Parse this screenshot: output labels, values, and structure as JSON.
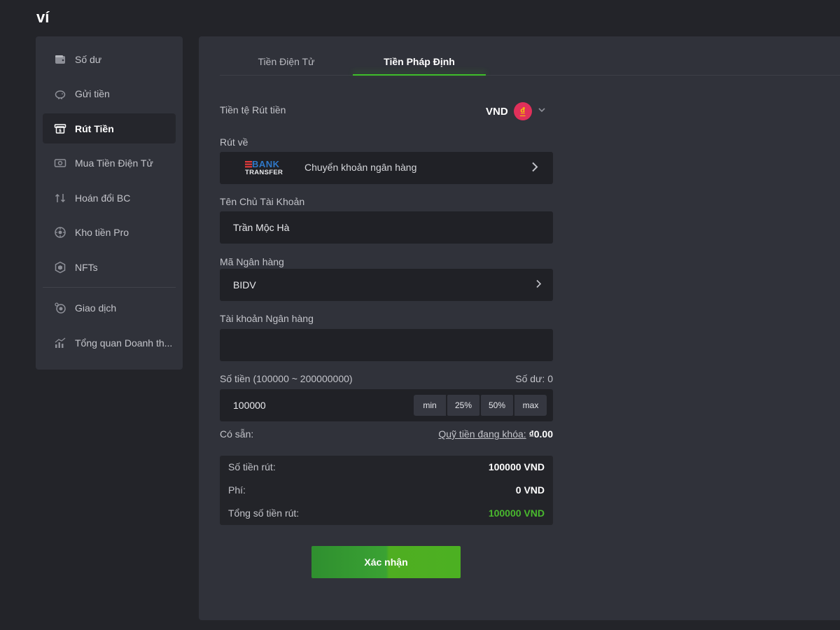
{
  "page": {
    "title": "ví"
  },
  "sidebar": {
    "items": [
      {
        "label": "Số dư",
        "icon": "wallet-icon"
      },
      {
        "label": "Gửi tiền",
        "icon": "piggy-bank-icon"
      },
      {
        "label": "Rút Tiền",
        "icon": "withdraw-icon",
        "active": true
      },
      {
        "label": "Mua Tiền Điện Tử",
        "icon": "buy-crypto-icon"
      },
      {
        "label": "Hoán đổi BC",
        "icon": "swap-icon"
      },
      {
        "label": "Kho tiền Pro",
        "icon": "vault-icon"
      },
      {
        "label": "NFTs",
        "icon": "nft-icon"
      },
      {
        "label": "Giao dịch",
        "icon": "transactions-icon"
      },
      {
        "label": "Tổng quan Doanh th...",
        "icon": "chart-icon"
      }
    ]
  },
  "tabs": [
    {
      "label": "Tiền Điện Tử"
    },
    {
      "label": "Tiền Pháp Định",
      "active": true
    }
  ],
  "form": {
    "currency_label": "Tiền tệ Rút tiền",
    "currency_code": "VND",
    "currency_symbol": "₫",
    "withdraw_to_label": "Rút về",
    "bank_logo_top": "BANK",
    "bank_logo_bottom": "TRANSFER",
    "withdraw_method": "Chuyển khoản ngân hàng",
    "account_name_label": "Tên Chủ Tài Khoản",
    "account_name_value": "Trần Mộc Hà",
    "bank_code_label": "Mã Ngân hàng",
    "bank_code_value": "BIDV",
    "bank_account_label": "Tài khoản Ngân hàng",
    "bank_account_value": "",
    "amount_label": "Số tiền (100000 ~ 200000000)",
    "balance_label": "Số dư: 0",
    "amount_value": "100000",
    "quick_buttons": [
      "min",
      "25%",
      "50%",
      "max"
    ],
    "available_label": "Có sẵn:",
    "locked_funds_link": "Quỹ tiền đang khóa:",
    "locked_funds_value": "₫0.00"
  },
  "summary": {
    "withdraw_amount_label": "Số tiền rút:",
    "withdraw_amount_value": "100000 VND",
    "fee_label": "Phí:",
    "fee_value": "0 VND",
    "total_label": "Tổng số tiền rút:",
    "total_value": "100000 VND"
  },
  "confirm_label": "Xác nhận",
  "colors": {
    "accent": "#3fbf2a",
    "total_green": "#49b82e",
    "panel": "#30323a",
    "background": "#232429"
  }
}
